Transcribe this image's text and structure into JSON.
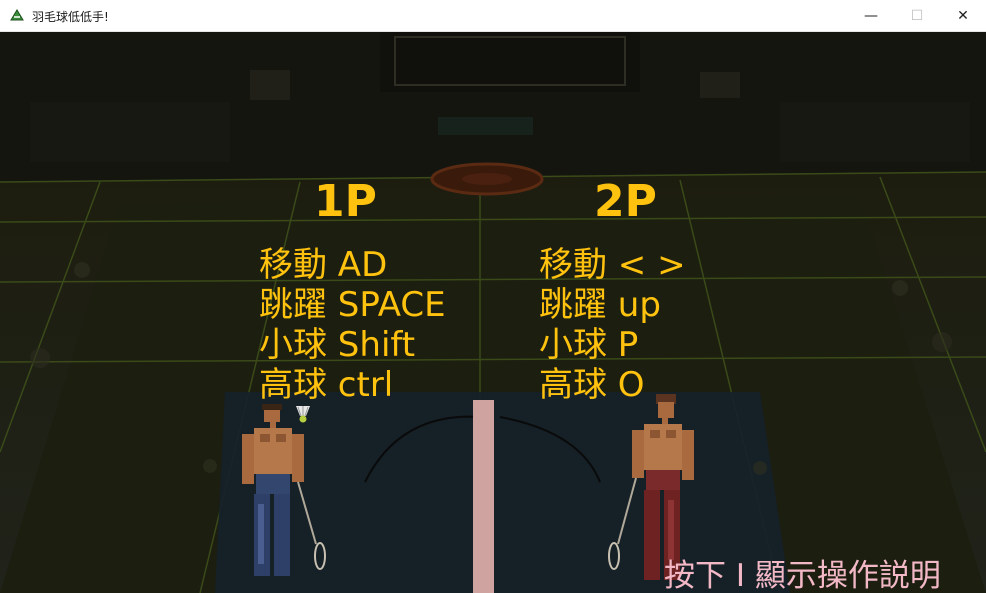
{
  "window": {
    "title": "羽毛球低低手!",
    "buttons": {
      "minimize": "—",
      "maximize": "☐",
      "close": "✕"
    }
  },
  "player1": {
    "heading": "1P",
    "controls": [
      "移動 AD",
      "跳躍 SPACE",
      "小球 Shift",
      "高球 ctrl"
    ]
  },
  "player2": {
    "heading": "2P",
    "controls": [
      "移動 < >",
      "跳躍 up",
      "小球 P",
      "高球 O"
    ]
  },
  "hint": "按下 I 顯示操作説明",
  "colors": {
    "text": "#ffc20e",
    "hint": "#f2b8c6",
    "net": "#cfa39f"
  }
}
